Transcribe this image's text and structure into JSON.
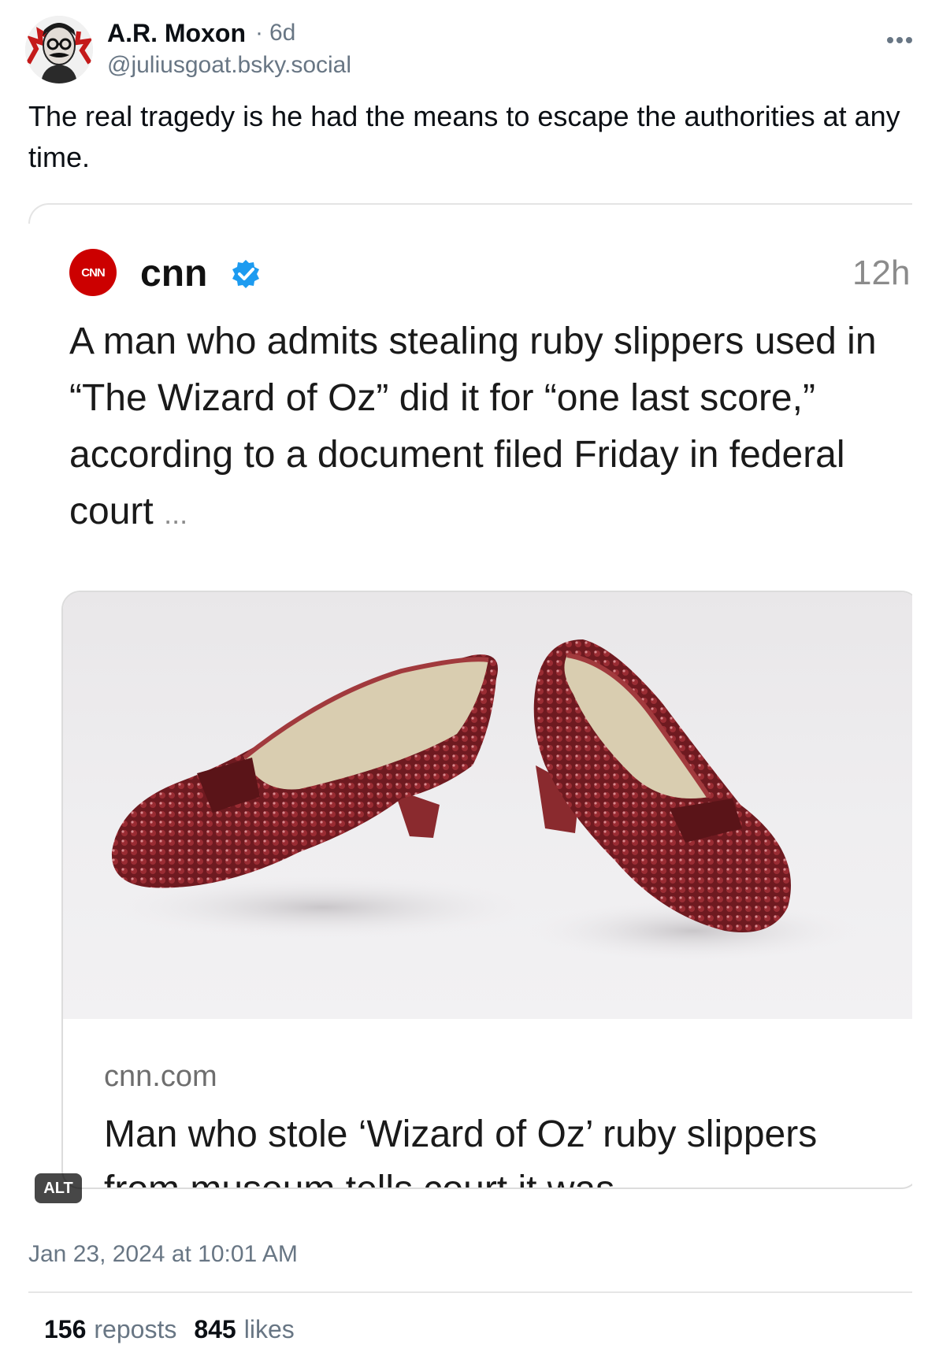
{
  "post": {
    "author_name": "A.R. Moxon",
    "separator": "·",
    "age": "6d",
    "handle": "@juliusgoat.bsky.social",
    "text": "The real tragedy is he had the means to escape the authorities at any time.",
    "more_icon": "ellipsis-horizontal-icon",
    "avatar_icon": "avatar-image"
  },
  "embed": {
    "source_logo_text": "CNN",
    "source_name": "cnn",
    "verified_icon": "verified-badge-icon",
    "time": "12h",
    "body": "A man who admits stealing ruby slippers used in “The Wizard of Oz” did it for “one last score,” according to a document filed Friday in federal court",
    "ellipsis": "...",
    "link_card": {
      "image": "ruby-slippers-photo",
      "domain": "cnn.com",
      "title": "Man who stole ‘Wizard of Oz’ ruby slippers from museum tells court it was..."
    }
  },
  "alt_badge": "ALT",
  "timestamp": "Jan 23, 2024 at 10:01 AM",
  "stats": {
    "reposts_count": "156",
    "reposts_label": "reposts",
    "likes_count": "845",
    "likes_label": "likes"
  },
  "colors": {
    "text": "#0b0f14",
    "muted": "#687684",
    "cnn_red": "#cc0000",
    "verified_blue": "#1d9bf0",
    "slipper_red": "#7a1c22"
  }
}
